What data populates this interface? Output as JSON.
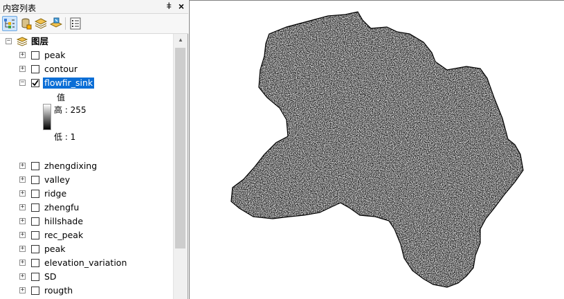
{
  "toc": {
    "title": "内容列表",
    "pin_glyph": "ǂ",
    "close_glyph": "×",
    "toolbar": [
      {
        "name": "list-by-drawing-order-button",
        "icon": "list-by-drawing-order-icon",
        "active": true
      },
      {
        "name": "list-by-source-button",
        "icon": "database-icon",
        "active": false
      },
      {
        "name": "list-by-visibility-button",
        "icon": "layers-visibility-icon",
        "active": false
      },
      {
        "name": "list-by-selection-button",
        "icon": "selection-icon",
        "active": false
      },
      {
        "name": "options-button",
        "icon": "options-icon",
        "active": false
      }
    ],
    "root": {
      "label": "图层",
      "expanded": true
    },
    "layers": [
      {
        "name": "peak",
        "checked": false,
        "expanded": false,
        "selected": false
      },
      {
        "name": "contour",
        "checked": false,
        "expanded": false,
        "selected": false
      },
      {
        "name": "flowfir_sink",
        "checked": true,
        "expanded": true,
        "selected": true
      },
      {
        "name": "zhengdixing",
        "checked": false,
        "expanded": false,
        "selected": false
      },
      {
        "name": "valley",
        "checked": false,
        "expanded": false,
        "selected": false
      },
      {
        "name": "ridge",
        "checked": false,
        "expanded": false,
        "selected": false
      },
      {
        "name": "zhengfu",
        "checked": false,
        "expanded": false,
        "selected": false
      },
      {
        "name": "hillshade",
        "checked": false,
        "expanded": false,
        "selected": false
      },
      {
        "name": "rec_peak",
        "checked": false,
        "expanded": false,
        "selected": false
      },
      {
        "name": "peak",
        "checked": false,
        "expanded": false,
        "selected": false
      },
      {
        "name": "elevation_variation",
        "checked": false,
        "expanded": false,
        "selected": false
      },
      {
        "name": "SD",
        "checked": false,
        "expanded": false,
        "selected": false
      },
      {
        "name": "rougth",
        "checked": false,
        "expanded": false,
        "selected": false
      }
    ],
    "legend": {
      "heading": "值",
      "high": "高 : 255",
      "low": "低 : 1",
      "ramp_colors": [
        "#ffffff",
        "#000000"
      ]
    }
  },
  "map": {
    "background": "#ffffff",
    "raster_color": "#1a1a1a"
  }
}
